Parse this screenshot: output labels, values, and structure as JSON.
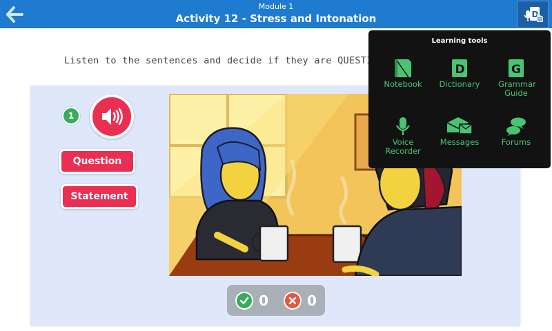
{
  "header": {
    "module": "Module 1",
    "activity": "Activity 12 - Stress and Intonation"
  },
  "instruction": "Listen to the sentences and decide if they are QUESTIONS or STATEMENTS",
  "item_number": "1",
  "answers": {
    "question": "Question",
    "statement": "Statement"
  },
  "score": {
    "correct": "0",
    "wrong": "0"
  },
  "learning_tools": {
    "title": "Learning tools",
    "items": [
      {
        "label": "Notebook",
        "icon": "notebook-icon"
      },
      {
        "label": "Dictionary",
        "icon": "dictionary-icon"
      },
      {
        "label": "Grammar Guide",
        "icon": "grammar-guide-icon"
      },
      {
        "label": "Voice Recorder",
        "icon": "microphone-icon"
      },
      {
        "label": "Messages",
        "icon": "messages-icon"
      },
      {
        "label": "Forums",
        "icon": "forums-icon"
      }
    ]
  },
  "colors": {
    "topbar": "#1f7bd0",
    "accent_red": "#ea2f52",
    "panel_bg": "#dfe8fb",
    "tool_green": "#49c474",
    "correct_green": "#3aab5c"
  }
}
